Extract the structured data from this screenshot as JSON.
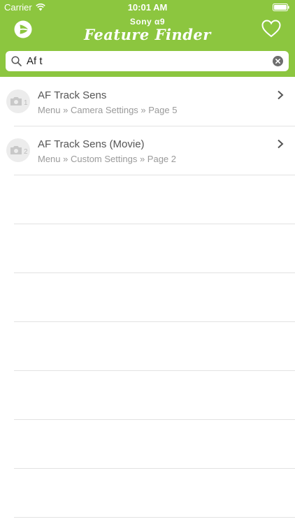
{
  "status_bar": {
    "carrier": "Carrier",
    "time": "10:01 AM"
  },
  "nav": {
    "brand": "Sony α9",
    "app_title": "Feature Finder",
    "logo_icon": "play-logo-icon",
    "favorites_icon": "heart-icon"
  },
  "search": {
    "value": "Af t",
    "search_icon": "search-icon",
    "clear_icon": "clear-circle-icon"
  },
  "results": [
    {
      "title": "AF Track Sens",
      "path": "Menu » Camera Settings » Page 5",
      "badge": "1"
    },
    {
      "title": "AF Track Sens (Movie)",
      "path": "Menu » Custom Settings » Page 2",
      "badge": "2"
    }
  ],
  "colors": {
    "header_green": "#8cc63f",
    "divider": "#e2e2e2"
  }
}
